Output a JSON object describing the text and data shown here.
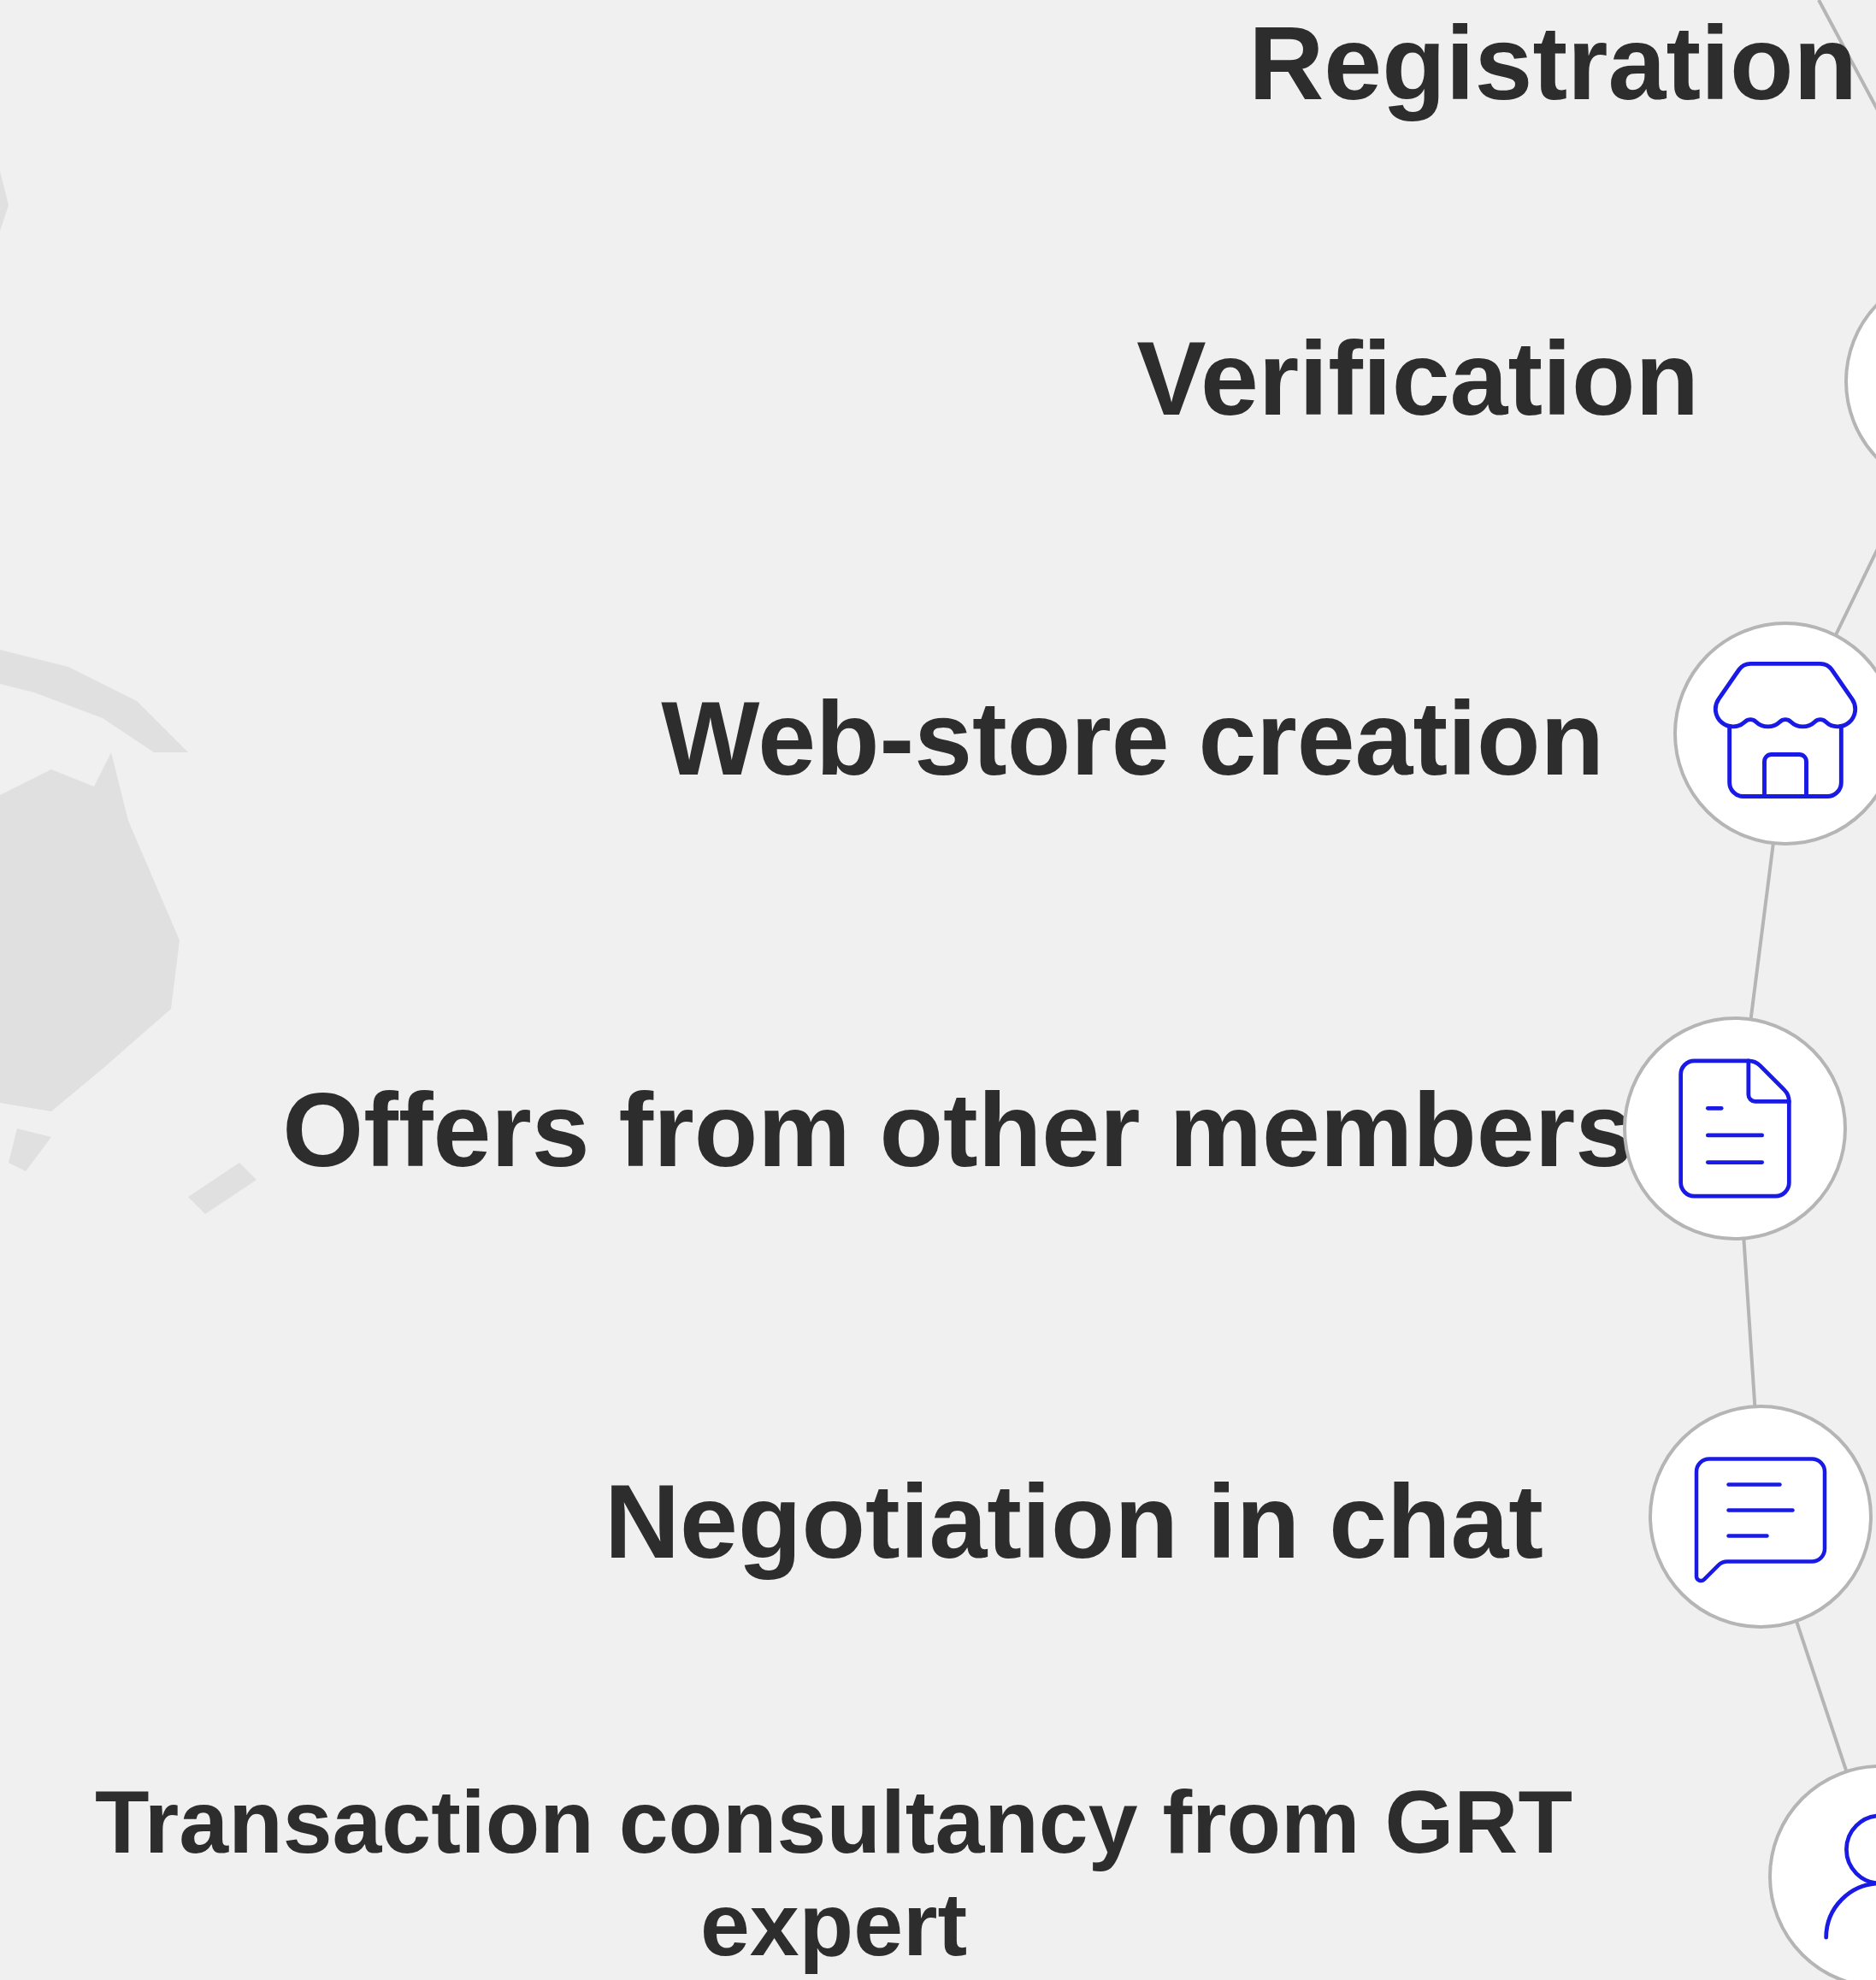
{
  "steps": [
    {
      "label": "Registration"
    },
    {
      "label": "Verification"
    },
    {
      "label": "Web-store creation"
    },
    {
      "label": "Offers from other members"
    },
    {
      "label": "Negotiation in chat"
    },
    {
      "label": "Transaction consultancy from GRT expert"
    }
  ]
}
